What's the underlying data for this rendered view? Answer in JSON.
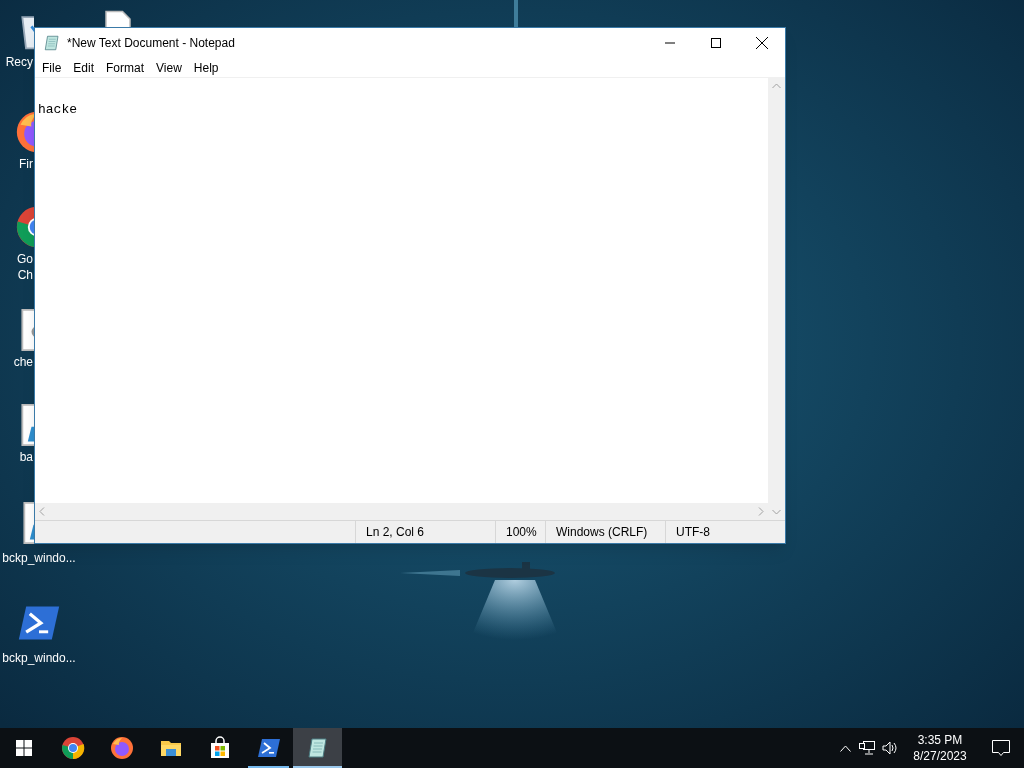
{
  "desktop_icons": [
    {
      "kind": "bin",
      "lines": [
        "Recy"
      ],
      "clipped": true
    },
    {
      "kind": "firefox",
      "lines": [
        "Fir"
      ],
      "clipped": true
    },
    {
      "kind": "chrome",
      "lines": [
        "Go",
        "Ch"
      ],
      "clipped": true
    },
    {
      "kind": "file",
      "lines": [
        "che"
      ],
      "clipped": true
    },
    {
      "kind": "script",
      "lines": [
        "ba"
      ],
      "clipped": true
    },
    {
      "kind": "script",
      "lines": [
        "bckp_windo..."
      ],
      "clipped": false
    },
    {
      "kind": "powershell",
      "lines": [
        "bckp_windo..."
      ],
      "clipped": false
    }
  ],
  "window": {
    "title": "*New Text Document - Notepad",
    "menu": [
      "File",
      "Edit",
      "Format",
      "View",
      "Help"
    ],
    "content": "hacke",
    "status": [
      "Ln 2, Col 6",
      "100%",
      "Windows (CRLF)",
      "UTF-8"
    ]
  },
  "taskbar": {
    "apps": [
      {
        "kind": "chrome",
        "selected": false,
        "running": false
      },
      {
        "kind": "firefox",
        "selected": false,
        "running": false
      },
      {
        "kind": "folder",
        "selected": false,
        "running": false
      },
      {
        "kind": "store",
        "selected": false,
        "running": false
      },
      {
        "kind": "powershell",
        "selected": false,
        "running": true
      },
      {
        "kind": "notepad",
        "selected": true,
        "running": true
      }
    ],
    "time": "3:35 PM",
    "date": "8/27/2023"
  }
}
